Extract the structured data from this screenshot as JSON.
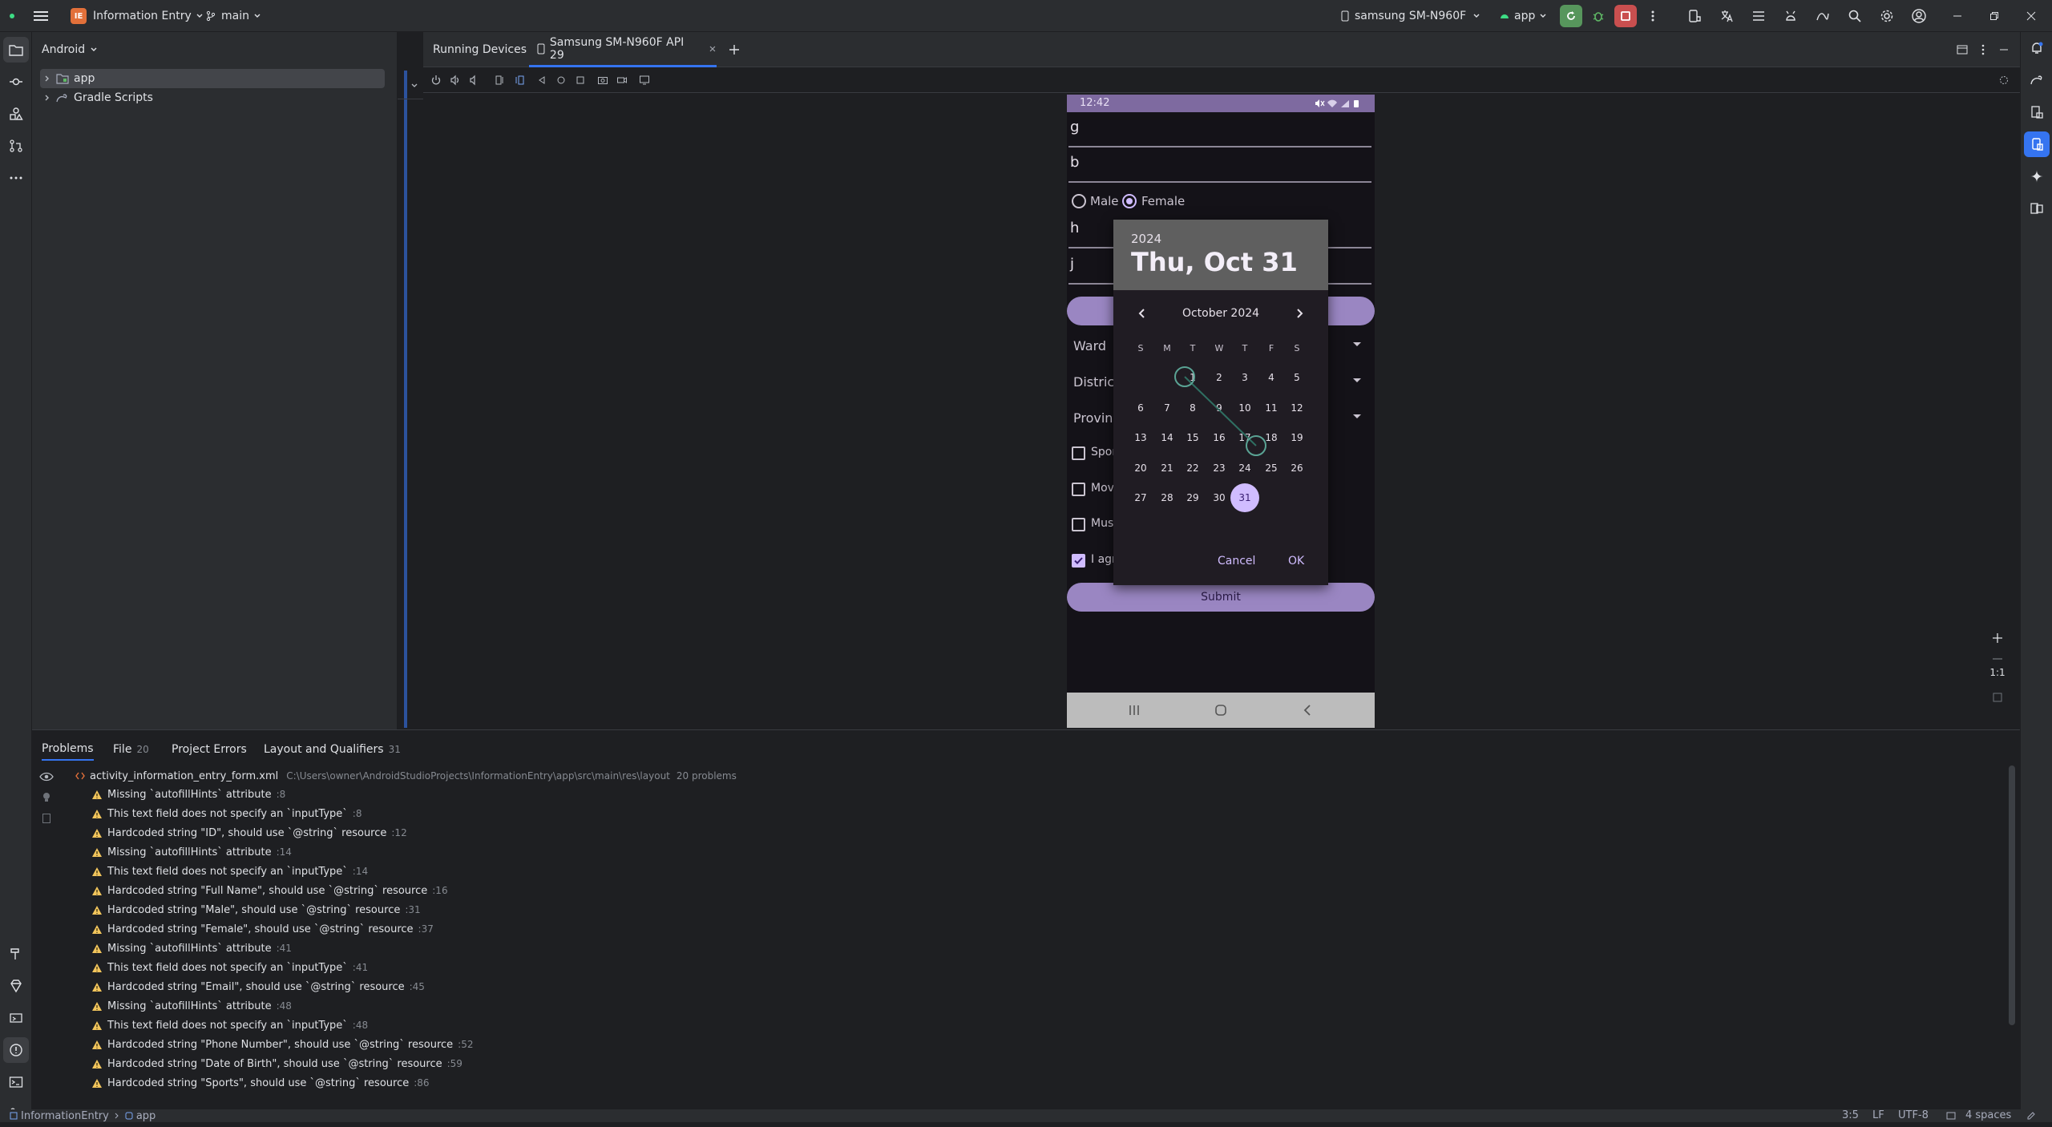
{
  "titlebar": {
    "project_badge": "IE",
    "project_name": "Information Entry",
    "branch": "main",
    "device": "samsung SM-N960F",
    "run_config": "app"
  },
  "project_panel": {
    "view_selector": "Android",
    "tree": [
      {
        "label": "app",
        "selected": true
      },
      {
        "label": "Gradle Scripts",
        "selected": false
      }
    ]
  },
  "device_panel": {
    "title": "Running Devices",
    "tab_label": "Samsung SM-N960F API 29",
    "zoom_label": "1:1"
  },
  "phone": {
    "status_time": "12:42",
    "fields": [
      "g",
      "b",
      "h",
      "j"
    ],
    "gender_male": "Male",
    "gender_female": "Female",
    "gender_selected": "Female",
    "ward_label": "Ward",
    "district_label": "District",
    "province_label": "Provinc",
    "checkboxes": [
      {
        "label": "Spor",
        "checked": false
      },
      {
        "label": "Mov",
        "checked": false
      },
      {
        "label": "Mus",
        "checked": false
      },
      {
        "label": "I agr",
        "checked": true
      }
    ],
    "submit_label": "Submit"
  },
  "datepicker": {
    "year": "2024",
    "date_heading": "Thu, Oct 31",
    "month_label": "October 2024",
    "weekdays": [
      "S",
      "M",
      "T",
      "W",
      "T",
      "F",
      "S"
    ],
    "first_weekday_index": 2,
    "days_in_month": 31,
    "selected_day": 31,
    "cancel_label": "Cancel",
    "ok_label": "OK"
  },
  "problems": {
    "tabs": [
      {
        "label": "Problems",
        "count": ""
      },
      {
        "label": "File",
        "count": "20"
      },
      {
        "label": "Project Errors",
        "count": ""
      },
      {
        "label": "Layout and Qualifiers",
        "count": "31"
      }
    ],
    "file_name": "activity_information_entry_form.xml",
    "file_path": "C:\\Users\\owner\\AndroidStudioProjects\\InformationEntry\\app\\src\\main\\res\\layout",
    "file_count": "20 problems",
    "items": [
      {
        "text": "Missing `autofillHints` attribute",
        "line": ":8"
      },
      {
        "text": "This text field does not specify an `inputType`",
        "line": ":8"
      },
      {
        "text": "Hardcoded string \"ID\", should use `@string` resource",
        "line": ":12"
      },
      {
        "text": "Missing `autofillHints` attribute",
        "line": ":14"
      },
      {
        "text": "This text field does not specify an `inputType`",
        "line": ":14"
      },
      {
        "text": "Hardcoded string \"Full Name\", should use `@string` resource",
        "line": ":16"
      },
      {
        "text": "Hardcoded string \"Male\", should use `@string` resource",
        "line": ":31"
      },
      {
        "text": "Hardcoded string \"Female\", should use `@string` resource",
        "line": ":37"
      },
      {
        "text": "Missing `autofillHints` attribute",
        "line": ":41"
      },
      {
        "text": "This text field does not specify an `inputType`",
        "line": ":41"
      },
      {
        "text": "Hardcoded string \"Email\", should use `@string` resource",
        "line": ":45"
      },
      {
        "text": "Missing `autofillHints` attribute",
        "line": ":48"
      },
      {
        "text": "This text field does not specify an `inputType`",
        "line": ":48"
      },
      {
        "text": "Hardcoded string \"Phone Number\", should use `@string` resource",
        "line": ":52"
      },
      {
        "text": "Hardcoded string \"Date of Birth\", should use `@string` resource",
        "line": ":59"
      },
      {
        "text": "Hardcoded string \"Sports\", should use `@string` resource",
        "line": ":86"
      }
    ]
  },
  "statusbar": {
    "breadcrumb_project": "InformationEntry",
    "breadcrumb_module": "app",
    "cursor": "3:5",
    "line_ending": "LF",
    "encoding": "UTF-8",
    "indent": "4 spaces"
  },
  "colors": {
    "accent": "#3574f0",
    "warning": "#f2c55c",
    "phone_primary": "#d0bcff",
    "button_bg": "#9a86c2"
  }
}
